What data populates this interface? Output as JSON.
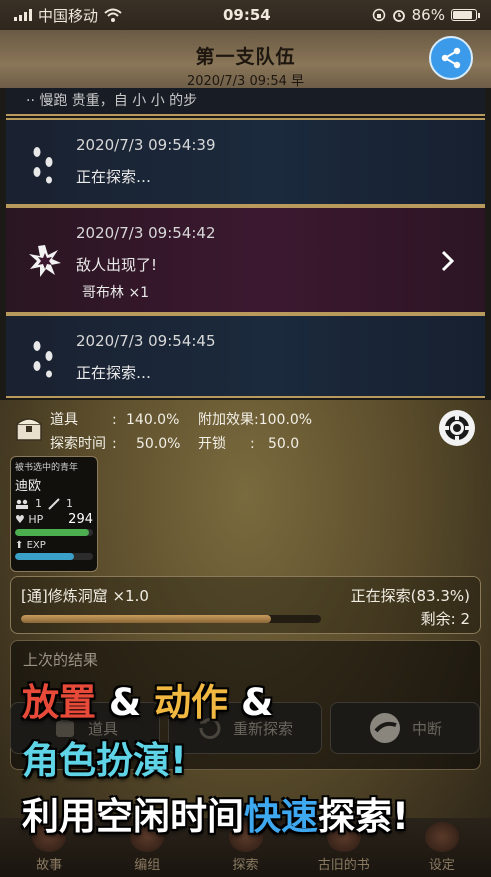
{
  "status_bar": {
    "carrier": "中国移动",
    "time": "09:54",
    "battery": "86%"
  },
  "header": {
    "title": "第一支队伍",
    "subtitle": "2020/7/3 09:54 早",
    "share_icon": "share-icon",
    "share_color": "#3b9bea"
  },
  "log": {
    "partial_text": "·· 慢跑 贵重，自 小 小 的步",
    "entries": [
      {
        "time": "2020/7/3 09:54:39",
        "message": "正在探索…",
        "icon": "footprints-icon"
      },
      {
        "time": "2020/7/3 09:54:42",
        "message": "敌人出现了!",
        "detail": "哥布林 ×1",
        "icon": "battle-icon"
      },
      {
        "time": "2020/7/3 09:54:45",
        "message": "正在探索…",
        "icon": "footprints-icon"
      }
    ]
  },
  "stats": {
    "item_label": "道具",
    "item_value": "140.0%",
    "bonus_label": "附加效果",
    "bonus_value": "100.0%",
    "time_label": "探索时间",
    "time_value": "50.0%",
    "unlock_label": "开锁",
    "unlock_value": "50.0"
  },
  "character": {
    "title": "被书选中的青年",
    "name": "迪欧",
    "party_count": "1",
    "attack_level": "1",
    "hp_label": "HP",
    "hp_value": "294",
    "hp_fill": 0.95,
    "exp_label": "EXP",
    "exp_fill": 0.75,
    "hp_color": "#4caf50",
    "exp_color": "#3aa0c8"
  },
  "exploration": {
    "location": "[通]修炼洞窟 ×1.0",
    "status": "正在探索(83.3%)",
    "remaining": "剩余: 2",
    "progress": 0.833
  },
  "result": {
    "title": "上次的结果"
  },
  "actions": {
    "items": "道具",
    "restart": "重新探索",
    "stop": "中断"
  },
  "tabs": [
    "故事",
    "编组",
    "探索",
    "古旧的书",
    "设定"
  ],
  "promo": {
    "line1_a": "放置",
    "line1_b": "&",
    "line1_c": "动作",
    "line1_d": "&",
    "line2": "角色扮演!",
    "line3_a": "利用空闲时间",
    "line3_b": "快速",
    "line3_c": "探索!",
    "colors": {
      "red": "#e84a3a",
      "gold": "#f0b840",
      "cyan": "#5fd4e6",
      "blue": "#3ea8f0"
    }
  }
}
